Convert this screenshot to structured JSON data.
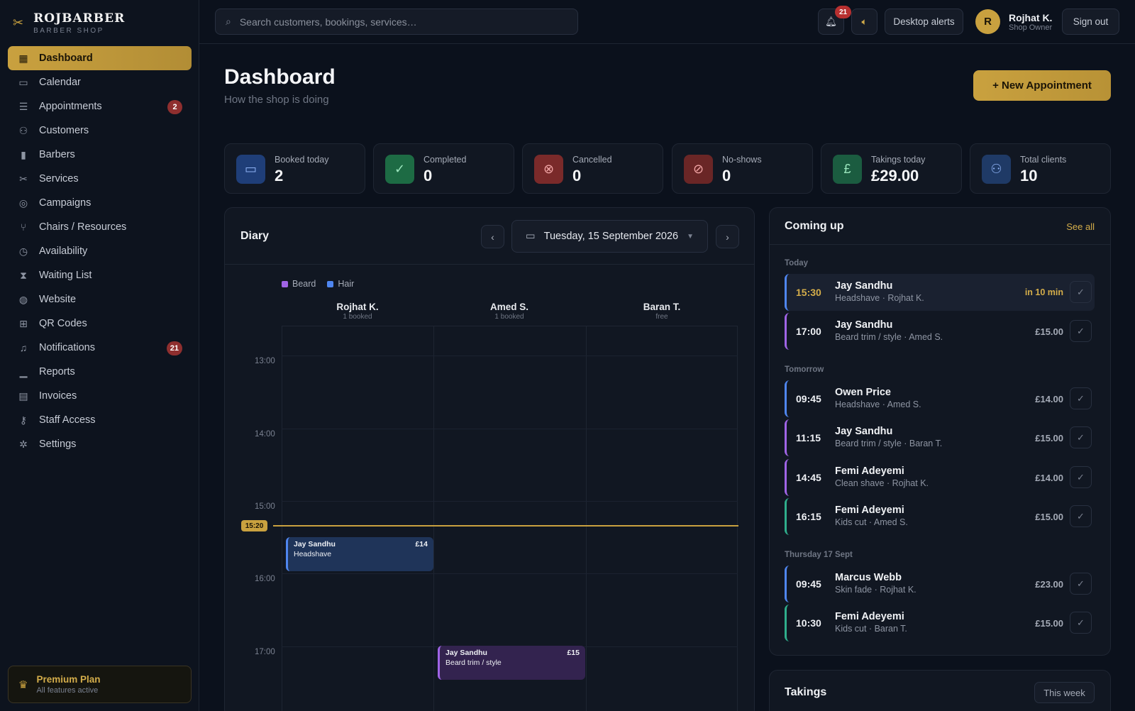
{
  "brand": {
    "name": "ROJBARBER",
    "sub": "BARBER SHOP",
    "logo_icon": "scissors-icon"
  },
  "sidebar": {
    "items": [
      {
        "label": "Dashboard",
        "icon": "grid-icon",
        "active": true
      },
      {
        "label": "Calendar",
        "icon": "calendar-icon"
      },
      {
        "label": "Appointments",
        "icon": "list-icon",
        "badge": "2"
      },
      {
        "label": "Customers",
        "icon": "users-icon"
      },
      {
        "label": "Barbers",
        "icon": "barber-pole-icon"
      },
      {
        "label": "Services",
        "icon": "scissors-icon"
      },
      {
        "label": "Campaigns",
        "icon": "target-icon"
      },
      {
        "label": "Chairs / Resources",
        "icon": "chair-icon"
      },
      {
        "label": "Availability",
        "icon": "clock-icon"
      },
      {
        "label": "Waiting List",
        "icon": "hourglass-icon"
      },
      {
        "label": "Website",
        "icon": "globe-icon"
      },
      {
        "label": "QR Codes",
        "icon": "qr-icon"
      },
      {
        "label": "Notifications",
        "icon": "bell-icon",
        "badge": "21"
      },
      {
        "label": "Reports",
        "icon": "bar-chart-icon"
      },
      {
        "label": "Invoices",
        "icon": "invoice-icon"
      },
      {
        "label": "Staff Access",
        "icon": "key-icon"
      },
      {
        "label": "Settings",
        "icon": "gear-icon"
      }
    ],
    "plan": {
      "title": "Premium Plan",
      "sub": "All features active"
    }
  },
  "topbar": {
    "search_placeholder": "Search customers, bookings, services…",
    "bell_badge": "21",
    "alerts_label": "Desktop alerts",
    "user": {
      "initial": "R",
      "name": "Rojhat K.",
      "role": "Shop Owner"
    },
    "signout_label": "Sign out"
  },
  "header": {
    "title": "Dashboard",
    "subtitle": "How the shop is doing",
    "new_button": "+ New Appointment"
  },
  "stats": [
    {
      "label": "Booked today",
      "value": "2",
      "icon": "calendar-icon",
      "color": "#1f3e78"
    },
    {
      "label": "Completed",
      "value": "0",
      "icon": "check-icon",
      "color": "#1d6b44"
    },
    {
      "label": "Cancelled",
      "value": "0",
      "icon": "x-circle-icon",
      "color": "#7a2a2a"
    },
    {
      "label": "No-shows",
      "value": "0",
      "icon": "ban-icon",
      "color": "#6a2626"
    },
    {
      "label": "Takings today",
      "value": "£29.00",
      "icon": "pound-icon",
      "color": "#1b5c40"
    },
    {
      "label": "Total clients",
      "value": "10",
      "icon": "users-icon",
      "color": "#1f3a66"
    }
  ],
  "diary": {
    "title": "Diary",
    "date": "Tuesday, 15 September 2026",
    "prev": "‹",
    "next": "›",
    "legend": [
      {
        "name": "Beard",
        "color": "#a064e6"
      },
      {
        "name": "Hair",
        "color": "#4f86f0"
      }
    ],
    "columns": [
      {
        "name": "Rojhat K.",
        "sub": "1 booked"
      },
      {
        "name": "Amed S.",
        "sub": "1 booked"
      },
      {
        "name": "Baran T.",
        "sub": "free"
      }
    ],
    "times": [
      "13:00",
      "14:00",
      "15:00",
      "16:00",
      "17:00"
    ],
    "now_time": "15:20",
    "appointments": [
      {
        "name": "Jay Sandhu",
        "service": "Headshave",
        "price": "£14"
      },
      {
        "name": "Jay Sandhu",
        "service": "Beard trim / style",
        "price": "£15"
      }
    ]
  },
  "coming_up": {
    "title": "Coming up",
    "see_all": "See all",
    "groups": [
      {
        "label": "Today",
        "items": [
          {
            "time": "15:30",
            "name": "Jay Sandhu",
            "sub": "Headshave · Rojhat K.",
            "right": "in 10 min",
            "color": "#4f86f0"
          },
          {
            "time": "17:00",
            "name": "Jay Sandhu",
            "sub": "Beard trim / style · Amed S.",
            "right": "£15.00",
            "color": "#a064e6"
          }
        ]
      },
      {
        "label": "Tomorrow",
        "items": [
          {
            "time": "09:45",
            "name": "Owen Price",
            "sub": "Headshave · Amed S.",
            "right": "£14.00",
            "color": "#4f86f0"
          },
          {
            "time": "11:15",
            "name": "Jay Sandhu",
            "sub": "Beard trim / style · Baran T.",
            "right": "£15.00",
            "color": "#a064e6"
          },
          {
            "time": "14:45",
            "name": "Femi Adeyemi",
            "sub": "Clean shave · Rojhat K.",
            "right": "£14.00",
            "color": "#a064e6"
          },
          {
            "time": "16:15",
            "name": "Femi Adeyemi",
            "sub": "Kids cut · Amed S.",
            "right": "£15.00",
            "color": "#2fae8c"
          }
        ]
      },
      {
        "label": "Thursday 17 Sept",
        "items": [
          {
            "time": "09:45",
            "name": "Marcus Webb",
            "sub": "Skin fade · Rojhat K.",
            "right": "£23.00",
            "color": "#4f86f0"
          },
          {
            "time": "10:30",
            "name": "Femi Adeyemi",
            "sub": "Kids cut · Baran T.",
            "right": "£15.00",
            "color": "#2fae8c"
          }
        ]
      }
    ]
  },
  "takings": {
    "title": "Takings",
    "range": "This week"
  }
}
